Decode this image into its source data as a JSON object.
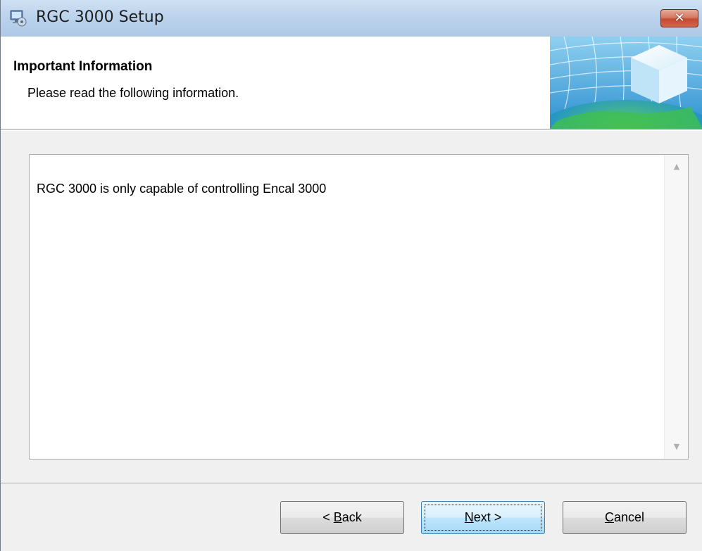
{
  "window": {
    "title": "RGC 3000 Setup",
    "close_label": "✕"
  },
  "header": {
    "title": "Important Information",
    "subtitle": "Please read the following information."
  },
  "memo": {
    "text": "RGC 3000 is only capable of controlling Encal 3000",
    "scroll_up_glyph": "▲",
    "scroll_down_glyph": "▼"
  },
  "buttons": {
    "back": {
      "prefix": "< ",
      "accel": "B",
      "rest": "ack"
    },
    "next": {
      "prefix": "",
      "accel": "N",
      "rest": "ext >"
    },
    "cancel": {
      "prefix": "",
      "accel": "C",
      "rest": "ancel"
    }
  },
  "icons": {
    "app": "setup-computer-icon",
    "close": "close-icon",
    "banner": "globe-cube-graphic"
  },
  "colors": {
    "titlebar": "#bcd3ec",
    "close_button": "#c64a2f",
    "default_button_border": "#3c7fb1"
  }
}
